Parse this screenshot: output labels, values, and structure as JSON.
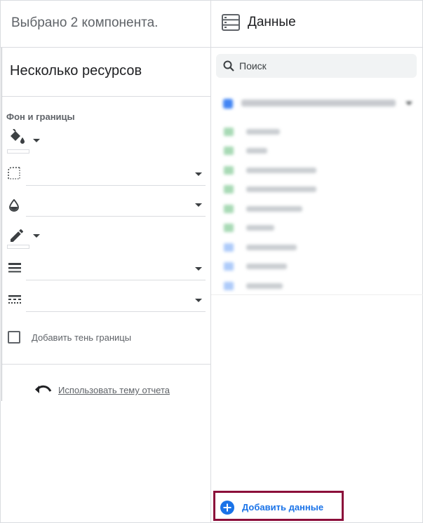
{
  "selection_header": {
    "text": "Выбрано 2 компонента."
  },
  "properties": {
    "title": "Несколько ресурсов",
    "section_label": "Фон и границы",
    "controls": [
      {
        "icon": "fill-color-icon",
        "kind": "color"
      },
      {
        "icon": "border-radius-icon",
        "kind": "dropdown",
        "value": ""
      },
      {
        "icon": "opacity-icon",
        "kind": "dropdown",
        "value": ""
      },
      {
        "icon": "border-color-icon",
        "kind": "color"
      },
      {
        "icon": "border-weight-icon",
        "kind": "dropdown",
        "value": ""
      },
      {
        "icon": "border-style-icon",
        "kind": "dropdown",
        "value": ""
      }
    ],
    "shadow_label": "Добавить тень границы",
    "shadow_checked": false,
    "theme_link": "Использовать тему отчета"
  },
  "data_panel": {
    "title": "Данные",
    "search_placeholder": "Поиск",
    "add_data_label": "Добавить данные"
  },
  "colors": {
    "accent": "#1a73e8",
    "highlight_border": "#8b0e3a",
    "dimension_field": "#34a853",
    "metric_field": "#4285f4"
  }
}
